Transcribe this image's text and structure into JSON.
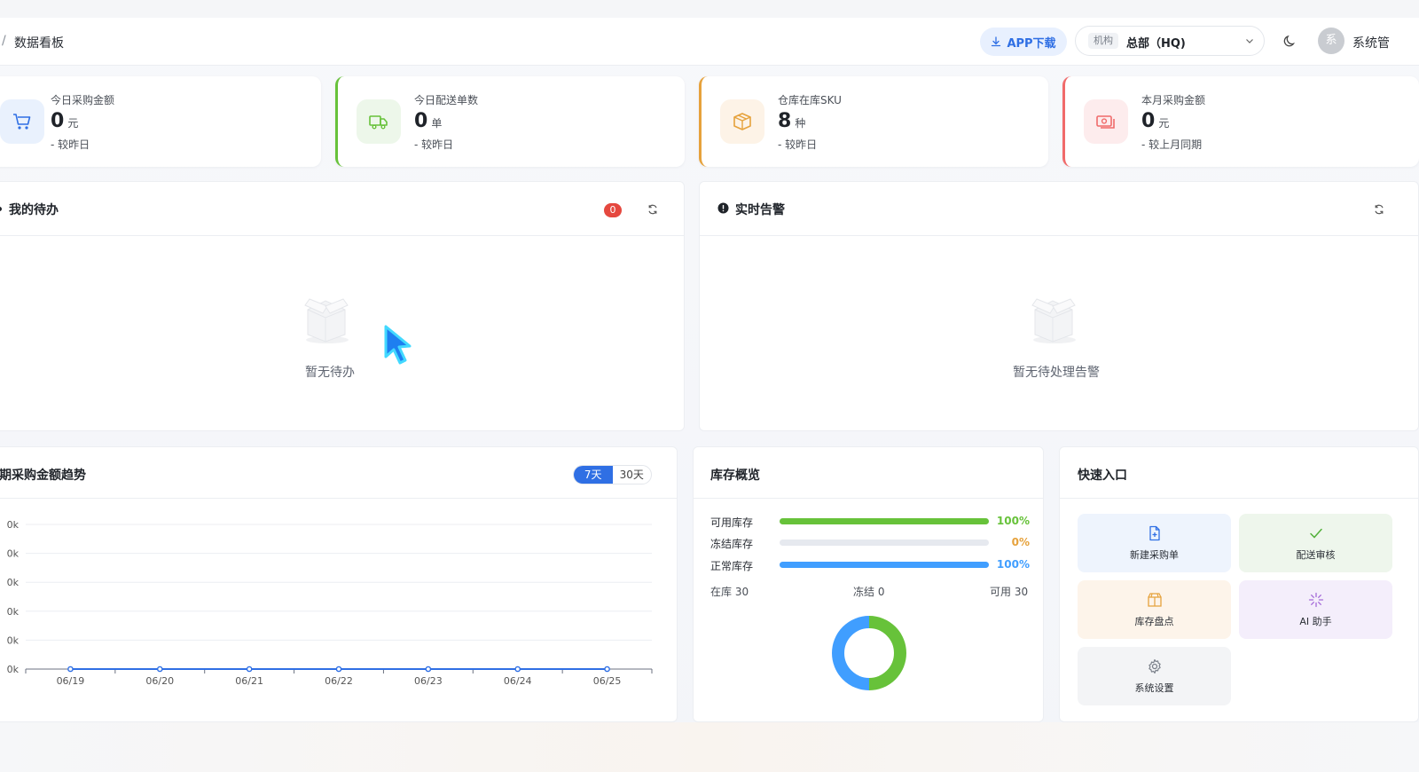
{
  "header": {
    "breadcrumb_sep": "/",
    "breadcrumb": "数据看板",
    "app_download": "APP下载",
    "org_tag": "机构",
    "org_value": "总部（HQ)",
    "avatar_char": "系",
    "user_name": "系统管"
  },
  "stats": [
    {
      "label": "今日采购金额",
      "value": "0",
      "unit": "元",
      "sub": "- 较昨日",
      "icon": "cart-icon",
      "color": "#2f6fe4"
    },
    {
      "label": "今日配送单数",
      "value": "0",
      "unit": "单",
      "sub": "- 较昨日",
      "icon": "truck-icon",
      "color": "#67c23a"
    },
    {
      "label": "仓库在库SKU",
      "value": "8",
      "unit": "种",
      "sub": "- 较昨日",
      "icon": "box-icon",
      "color": "#e6a23c"
    },
    {
      "label": "本月采购金额",
      "value": "0",
      "unit": "元",
      "sub": "- 较上月同期",
      "icon": "money-icon",
      "color": "#f06a6a"
    }
  ],
  "todo": {
    "title": "我的待办",
    "badge": "0",
    "empty": "暂无待办"
  },
  "alerts": {
    "title": "实时告警",
    "empty": "暂无待处理告警"
  },
  "trend": {
    "title": "近期采购金额趋势",
    "seg_7": "7天",
    "seg_30": "30天",
    "active": "7天"
  },
  "chart_data": {
    "type": "line",
    "x": [
      "06/19",
      "06/20",
      "06/21",
      "06/22",
      "06/23",
      "06/24",
      "06/25"
    ],
    "values": [
      0,
      0,
      0,
      0,
      0,
      0,
      0
    ],
    "ytick_labels": [
      "0k",
      "0k",
      "0k",
      "0k",
      "0k",
      "0k"
    ],
    "grid": true,
    "color": "#2f6fe4"
  },
  "inventory": {
    "title": "库存概览",
    "rows": [
      {
        "label": "可用库存",
        "pct": "100%",
        "value": 1.0,
        "color": "#67c23a"
      },
      {
        "label": "冻结库存",
        "pct": "0%",
        "value": 0.0,
        "color": "#e6a23c"
      },
      {
        "label": "正常库存",
        "pct": "100%",
        "value": 1.0,
        "color": "#409eff"
      }
    ],
    "in_stock": "在库 30",
    "frozen": "冻结 0",
    "available": "可用 30",
    "donut": [
      {
        "name": "可用",
        "value": 30,
        "color": "#67c23a"
      },
      {
        "name": "正常",
        "value": 30,
        "color": "#409eff"
      }
    ]
  },
  "quick": {
    "title": "快速入口",
    "items": [
      {
        "label": "新建采购单",
        "icon": "file-plus-icon",
        "bg": "#eef4fd",
        "color": "#2f6fe4"
      },
      {
        "label": "配送审核",
        "icon": "check-icon",
        "bg": "#eef6ec",
        "color": "#52b03a"
      },
      {
        "label": "库存盘点",
        "icon": "box-icon",
        "bg": "#fdf4ea",
        "color": "#e6a23c"
      },
      {
        "label": "AI 助手",
        "icon": "sparkle-icon",
        "bg": "#f4eefb",
        "color": "#a46ad8"
      },
      {
        "label": "系统设置",
        "icon": "gear-icon",
        "bg": "#f3f4f6",
        "color": "#7a808a"
      }
    ]
  }
}
